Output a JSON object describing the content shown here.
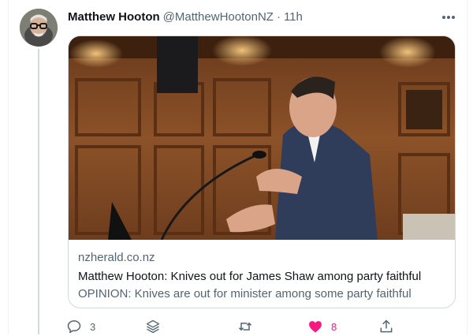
{
  "tweet": {
    "author_name": "Matthew Hooton",
    "author_handle": "@MatthewHootonNZ",
    "separator": "·",
    "time": "11h"
  },
  "card": {
    "domain": "nzherald.co.nz",
    "title": "Matthew Hooton: Knives out for James Shaw among party faithful",
    "description": "OPINION: Knives are out for minister among some party faithful"
  },
  "actions": {
    "reply_count": "3",
    "like_count": "8"
  },
  "colors": {
    "like_active": "#f91880",
    "secondary_text": "#536471",
    "thread_line": "#cfd9de"
  },
  "icons": [
    "more-icon",
    "reply-icon",
    "stack-icon",
    "retweet-icon",
    "heart-icon",
    "share-icon"
  ]
}
